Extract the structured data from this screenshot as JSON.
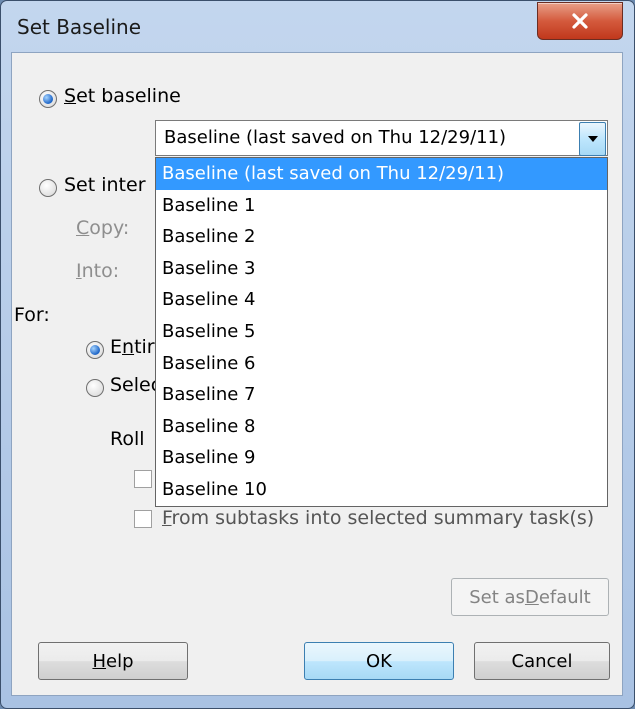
{
  "window": {
    "title": "Set Baseline",
    "close_glyph": "✕"
  },
  "set_baseline_radio": {
    "label_u": "S",
    "label_rest": "et baseline",
    "checked": true
  },
  "baseline_combo": {
    "value": "Baseline (last saved on Thu 12/29/11)"
  },
  "dropdown": {
    "items": [
      "Baseline (last saved on Thu 12/29/11)",
      "Baseline 1",
      "Baseline 2",
      "Baseline 3",
      "Baseline 4",
      "Baseline 5",
      "Baseline 6",
      "Baseline 7",
      "Baseline 8",
      "Baseline 9",
      "Baseline 10"
    ],
    "selected_index": 0
  },
  "set_interim_radio": {
    "label": "Set inter",
    "checked": false
  },
  "copy_label": {
    "u": "C",
    "rest": "opy:"
  },
  "into_label": {
    "u": "I",
    "rest": "nto:"
  },
  "for_label": "For:",
  "entire_radio": {
    "pre": "E",
    "u": "n",
    "rest": "tir",
    "checked": true
  },
  "selected_radio": {
    "label": "Selec",
    "checked": false
  },
  "roll_label": "Roll",
  "subtasks_checkbox": {
    "u": "F",
    "rest": "rom subtasks into selected summary task(s)"
  },
  "buttons": {
    "set_default_pre": "Set as ",
    "set_default_u": "D",
    "set_default_rest": "efault",
    "help_u": "H",
    "help_rest": "elp",
    "ok": "OK",
    "cancel": "Cancel"
  },
  "colors": {
    "selection_blue": "#3399ff",
    "close_red": "#c0381c",
    "chrome_blue": "#a9c2e3"
  }
}
